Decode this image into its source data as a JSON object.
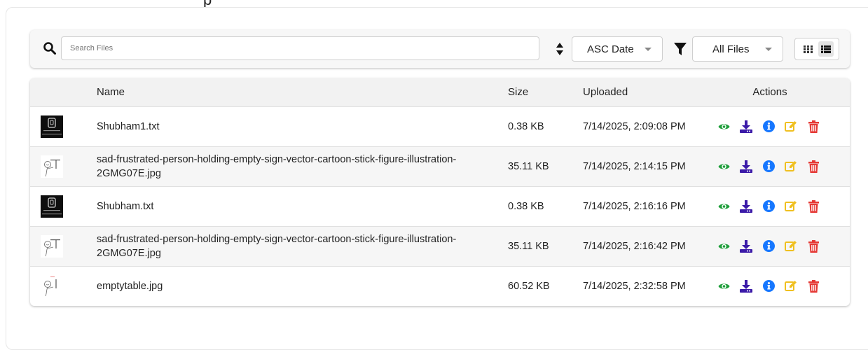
{
  "toolbar": {
    "search_placeholder": "Search Files",
    "search_value": "",
    "sort_value": "ASC Date",
    "type_filter_value": "All Files",
    "view_mode": "list"
  },
  "table": {
    "headers": {
      "name": "Name",
      "size": "Size",
      "uploaded": "Uploaded",
      "actions": "Actions"
    },
    "rows": [
      {
        "thumb": "text-doc",
        "name": "Shubham1.txt",
        "size": "0.38 KB",
        "uploaded": "7/14/2025, 2:09:08 PM"
      },
      {
        "thumb": "sketch",
        "name": "sad-frustrated-person-holding-empty-sign-vector-cartoon-stick-figure-illustration-2GMG07E.jpg",
        "size": "35.11 KB",
        "uploaded": "7/14/2025, 2:14:15 PM"
      },
      {
        "thumb": "text-doc",
        "name": "Shubham.txt",
        "size": "0.38 KB",
        "uploaded": "7/14/2025, 2:16:16 PM"
      },
      {
        "thumb": "sketch",
        "name": "sad-frustrated-person-holding-empty-sign-vector-cartoon-stick-figure-illustration-2GMG07E.jpg",
        "size": "35.11 KB",
        "uploaded": "7/14/2025, 2:16:42 PM"
      },
      {
        "thumb": "sketch-small",
        "name": "emptytable.jpg",
        "size": "60.52 KB",
        "uploaded": "7/14/2025, 2:32:58 PM"
      }
    ]
  },
  "action_icons": [
    {
      "name": "view-eye-icon",
      "color": "#1e9e3a"
    },
    {
      "name": "download-icon",
      "color": "#3b1aa8"
    },
    {
      "name": "info-icon",
      "color": "#1677ff"
    },
    {
      "name": "edit-icon",
      "color": "#f0c020"
    },
    {
      "name": "delete-trash-icon",
      "color": "#e53935"
    }
  ],
  "colors": {
    "view": "#1e9e3a",
    "download": "#3b1aa8",
    "info": "#1677ff",
    "edit": "#f0c020",
    "delete": "#e53935"
  }
}
